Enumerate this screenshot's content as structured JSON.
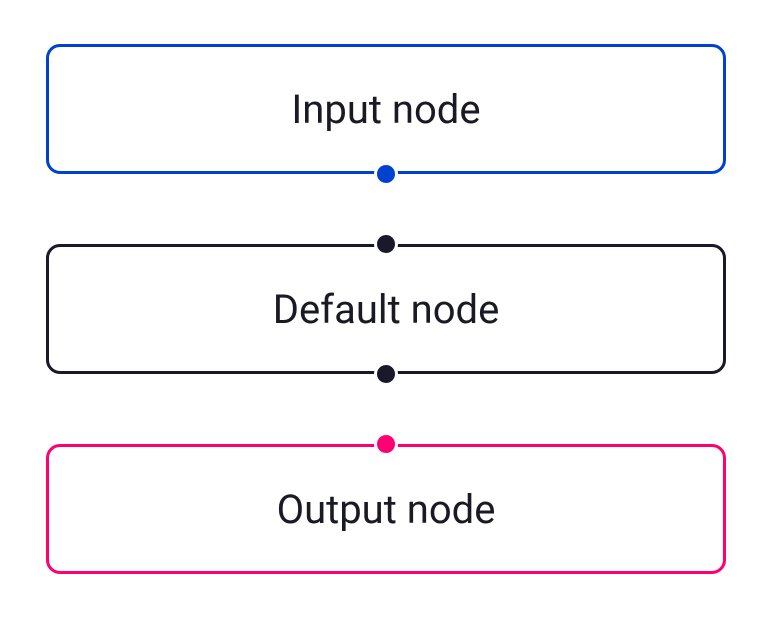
{
  "nodes": {
    "input": {
      "label": "Input node",
      "color": "#0041d0"
    },
    "default": {
      "label": "Default node",
      "color": "#1a192b"
    },
    "output": {
      "label": "Output node",
      "color": "#ff0072"
    }
  }
}
